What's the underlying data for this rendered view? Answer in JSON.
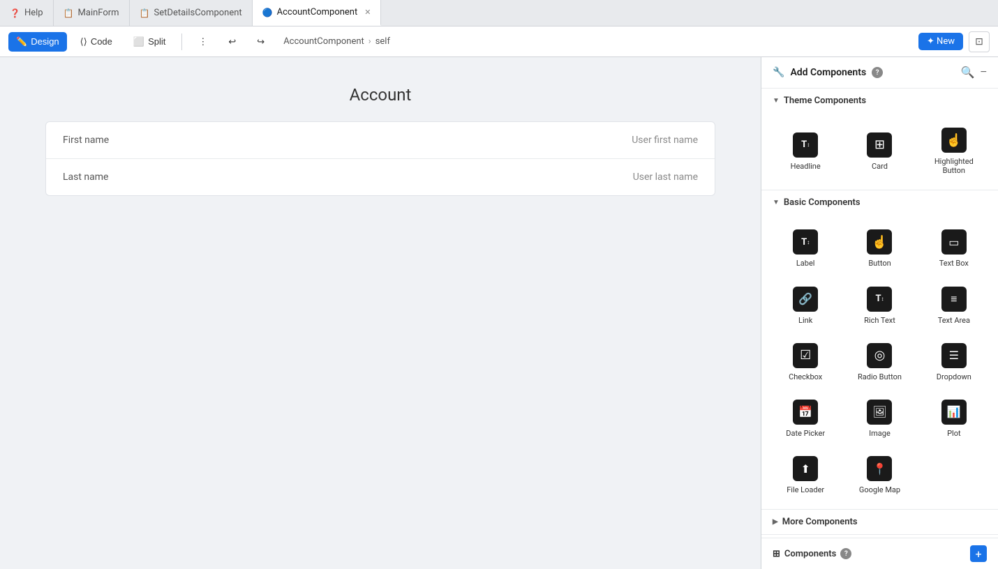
{
  "tabs": [
    {
      "id": "help",
      "label": "Help",
      "icon": "❓",
      "active": false,
      "closable": false
    },
    {
      "id": "mainform",
      "label": "MainForm",
      "icon": "📋",
      "active": false,
      "closable": false
    },
    {
      "id": "setdetails",
      "label": "SetDetailsComponent",
      "icon": "📋",
      "active": false,
      "closable": false
    },
    {
      "id": "account",
      "label": "AccountComponent",
      "icon": "🔵",
      "active": true,
      "closable": true
    }
  ],
  "toolbar": {
    "design_label": "Design",
    "code_label": "Code",
    "split_label": "Split",
    "new_label": "✦ New",
    "breadcrumb_main": "AccountComponent",
    "breadcrumb_sep": "›",
    "breadcrumb_sub": "self"
  },
  "canvas": {
    "page_title": "Account",
    "form_rows": [
      {
        "label": "First name",
        "value": "User first name"
      },
      {
        "label": "Last name",
        "value": "User last name"
      }
    ]
  },
  "right_panel": {
    "title": "Add Components",
    "help_badge": "?",
    "search_icon": "🔍",
    "collapse_icon": "−",
    "sections": [
      {
        "id": "theme",
        "label": "Theme Components",
        "expanded": true,
        "items": [
          {
            "id": "headline",
            "label": "Headline",
            "icon": "T↕"
          },
          {
            "id": "card",
            "label": "Card",
            "icon": "⊞"
          },
          {
            "id": "highlighted-button",
            "label": "Highlighted Button",
            "icon": "👆"
          }
        ]
      },
      {
        "id": "basic",
        "label": "Basic Components",
        "expanded": true,
        "items": [
          {
            "id": "label",
            "label": "Label",
            "icon": "T↕"
          },
          {
            "id": "button",
            "label": "Button",
            "icon": "👆"
          },
          {
            "id": "text-box",
            "label": "Text Box",
            "icon": "▭"
          },
          {
            "id": "link",
            "label": "Link",
            "icon": "🔗"
          },
          {
            "id": "rich-text",
            "label": "Rich Text",
            "icon": "T↕"
          },
          {
            "id": "text-area",
            "label": "Text Area",
            "icon": "≡"
          },
          {
            "id": "checkbox",
            "label": "Checkbox",
            "icon": "☑"
          },
          {
            "id": "radio-button",
            "label": "Radio Button",
            "icon": "◎"
          },
          {
            "id": "dropdown",
            "label": "Dropdown",
            "icon": "☰"
          },
          {
            "id": "date-picker",
            "label": "Date Picker",
            "icon": "📅"
          },
          {
            "id": "image",
            "label": "Image",
            "icon": "🖼"
          },
          {
            "id": "plot",
            "label": "Plot",
            "icon": "📊"
          },
          {
            "id": "file-loader",
            "label": "File Loader",
            "icon": "⬆"
          },
          {
            "id": "google-map",
            "label": "Google Map",
            "icon": "📍"
          }
        ]
      },
      {
        "id": "more",
        "label": "More Components",
        "expanded": false,
        "items": []
      }
    ]
  },
  "bottom_bar": {
    "label": "Components",
    "help_badge": "?",
    "add_icon": "+"
  }
}
